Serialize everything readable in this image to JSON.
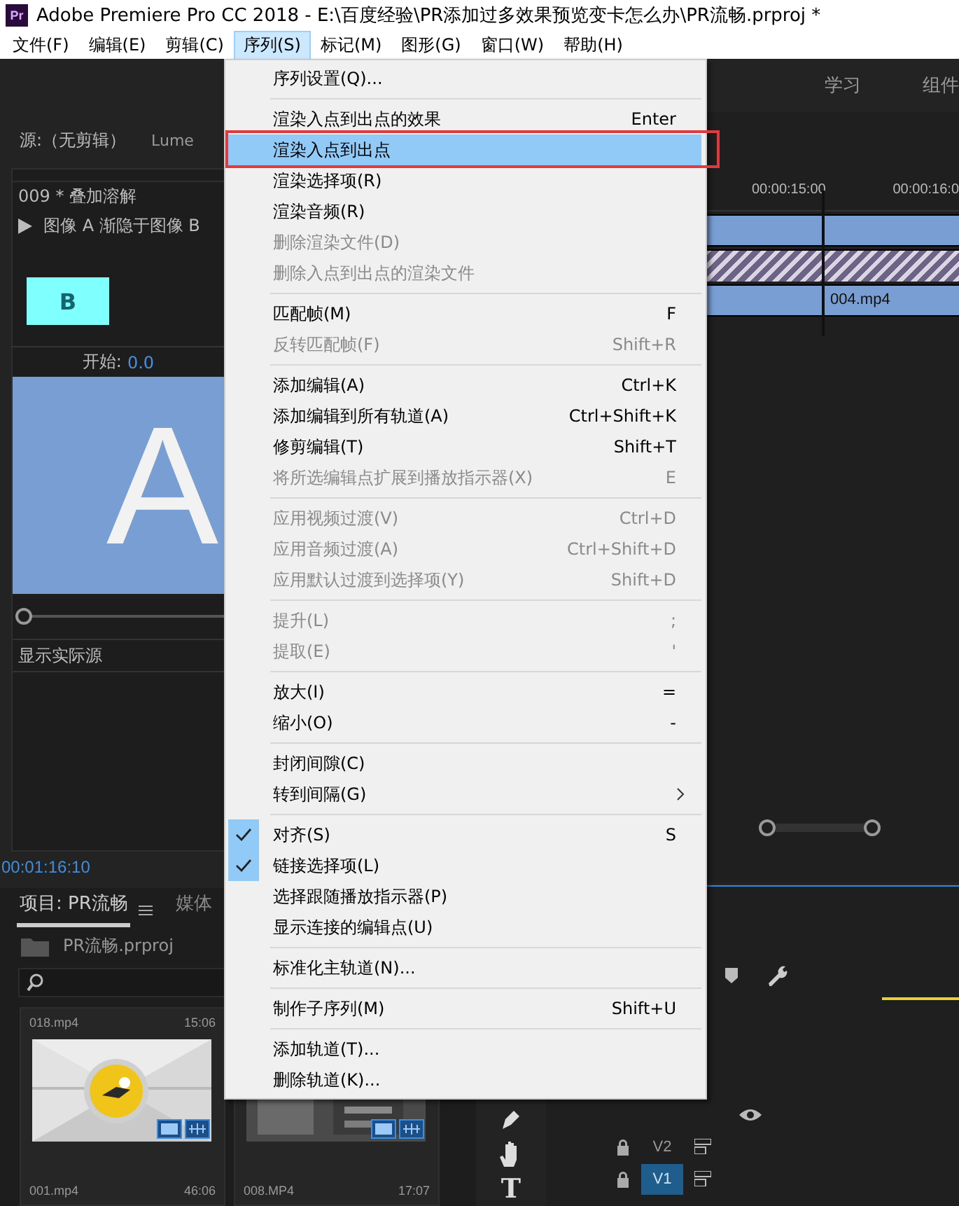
{
  "window": {
    "app_icon": "Pr",
    "title": "Adobe Premiere Pro CC 2018 - E:\\百度经验\\PR添加过多效果预览变卡怎么办\\PR流畅.prproj *"
  },
  "menu_bar": [
    {
      "label": "文件(F)",
      "selected": false
    },
    {
      "label": "编辑(E)",
      "selected": false
    },
    {
      "label": "剪辑(C)",
      "selected": false
    },
    {
      "label": "序列(S)",
      "selected": true
    },
    {
      "label": "标记(M)",
      "selected": false
    },
    {
      "label": "图形(G)",
      "selected": false
    },
    {
      "label": "窗口(W)",
      "selected": false
    },
    {
      "label": "帮助(H)",
      "selected": false
    }
  ],
  "workspaces": [
    "学习",
    "组件"
  ],
  "source_panel": {
    "tabs": [
      "源:（无剪辑）",
      "Lume"
    ]
  },
  "effect_controls": {
    "clip": "009 * 叠加溶解",
    "description": "图像 A 渐隐于图像 B",
    "thumb_b": "B",
    "start_label": "开始:",
    "start_value": "0.0",
    "preview_a": "A",
    "slider": {
      "level": 0
    },
    "show_source": "显示实际源",
    "timecode": "00:01:16:10"
  },
  "timeline": {
    "ruler": [
      "00:00:15:00",
      "00:00:16:0"
    ],
    "clips": [
      {
        "kind": "video"
      },
      {
        "kind": "transition"
      },
      {
        "kind": "video",
        "name": "004.mp4"
      }
    ],
    "track_labels": [
      {
        "label": "V2",
        "selected": false
      },
      {
        "label": "V1",
        "selected": true
      }
    ]
  },
  "tools": [
    {
      "kind": "pen"
    },
    {
      "kind": "hand"
    },
    {
      "kind": "type",
      "glyph": "T"
    }
  ],
  "project": {
    "tabs": [
      {
        "label": "项目: PR流畅",
        "selected": true
      },
      {
        "label": "媒体",
        "selected": false
      }
    ],
    "file": "PR流畅.prproj",
    "previous_row": [
      {
        "name": "018.mp4",
        "duration": "15:06"
      }
    ],
    "items": [
      {
        "name": "001.mp4",
        "duration": "46:06",
        "kind": "picture"
      },
      {
        "name": "008.MP4",
        "duration": "17:07",
        "kind": "picture"
      }
    ]
  },
  "menu": {
    "annotation_frame": true,
    "items": [
      {
        "kind": "item",
        "label": "序列设置(Q)...",
        "disabled": false,
        "checked": false,
        "selected": false
      },
      {
        "kind": "separator"
      },
      {
        "kind": "item",
        "label": "渲染入点到出点的效果",
        "shortcut": "Enter",
        "disabled": false,
        "checked": false,
        "selected": false
      },
      {
        "kind": "item",
        "label": "渲染入点到出点",
        "disabled": false,
        "checked": false,
        "selected": true
      },
      {
        "kind": "item",
        "label": "渲染选择项(R)",
        "disabled": false,
        "checked": false,
        "selected": false
      },
      {
        "kind": "item",
        "label": "渲染音频(R)",
        "disabled": false,
        "checked": false,
        "selected": false
      },
      {
        "kind": "item",
        "label": "删除渲染文件(D)",
        "disabled": true,
        "checked": false,
        "selected": false
      },
      {
        "kind": "item",
        "label": "删除入点到出点的渲染文件",
        "disabled": true,
        "checked": false,
        "selected": false
      },
      {
        "kind": "separator"
      },
      {
        "kind": "item",
        "label": "匹配帧(M)",
        "shortcut": "F",
        "disabled": false,
        "checked": false,
        "selected": false
      },
      {
        "kind": "item",
        "label": "反转匹配帧(F)",
        "shortcut": "Shift+R",
        "disabled": true,
        "checked": false,
        "selected": false
      },
      {
        "kind": "separator"
      },
      {
        "kind": "item",
        "label": "添加编辑(A)",
        "shortcut": "Ctrl+K",
        "disabled": false,
        "checked": false,
        "selected": false
      },
      {
        "kind": "item",
        "label": "添加编辑到所有轨道(A)",
        "shortcut": "Ctrl+Shift+K",
        "disabled": false,
        "checked": false,
        "selected": false
      },
      {
        "kind": "item",
        "label": "修剪编辑(T)",
        "shortcut": "Shift+T",
        "disabled": false,
        "checked": false,
        "selected": false
      },
      {
        "kind": "item",
        "label": "将所选编辑点扩展到播放指示器(X)",
        "shortcut": "E",
        "disabled": true,
        "checked": false,
        "selected": false
      },
      {
        "kind": "separator"
      },
      {
        "kind": "item",
        "label": "应用视频过渡(V)",
        "shortcut": "Ctrl+D",
        "disabled": true,
        "checked": false,
        "selected": false
      },
      {
        "kind": "item",
        "label": "应用音频过渡(A)",
        "shortcut": "Ctrl+Shift+D",
        "disabled": true,
        "checked": false,
        "selected": false
      },
      {
        "kind": "item",
        "label": "应用默认过渡到选择项(Y)",
        "shortcut": "Shift+D",
        "disabled": true,
        "checked": false,
        "selected": false
      },
      {
        "kind": "separator"
      },
      {
        "kind": "item",
        "label": "提升(L)",
        "shortcut": ";",
        "disabled": true,
        "checked": false,
        "selected": false
      },
      {
        "kind": "item",
        "label": "提取(E)",
        "shortcut": "'",
        "disabled": true,
        "checked": false,
        "selected": false
      },
      {
        "kind": "separator"
      },
      {
        "kind": "item",
        "label": "放大(I)",
        "shortcut": "=",
        "disabled": false,
        "checked": false,
        "selected": false
      },
      {
        "kind": "item",
        "label": "缩小(O)",
        "shortcut": "-",
        "disabled": false,
        "checked": false,
        "selected": false
      },
      {
        "kind": "separator"
      },
      {
        "kind": "item",
        "label": "封闭间隙(C)",
        "disabled": false,
        "checked": false,
        "selected": false
      },
      {
        "kind": "item",
        "label": "转到间隔(G)",
        "submenu": true,
        "disabled": false,
        "checked": false,
        "selected": false
      },
      {
        "kind": "separator"
      },
      {
        "kind": "item",
        "label": "对齐(S)",
        "shortcut": "S",
        "disabled": false,
        "checked": true,
        "selected": false
      },
      {
        "kind": "item",
        "label": "链接选择项(L)",
        "disabled": false,
        "checked": true,
        "selected": false
      },
      {
        "kind": "item",
        "label": "选择跟随播放指示器(P)",
        "disabled": false,
        "checked": false,
        "selected": false
      },
      {
        "kind": "item",
        "label": "显示连接的编辑点(U)",
        "disabled": false,
        "checked": false,
        "selected": false
      },
      {
        "kind": "separator"
      },
      {
        "kind": "item",
        "label": "标准化主轨道(N)...",
        "disabled": false,
        "checked": false,
        "selected": false
      },
      {
        "kind": "separator"
      },
      {
        "kind": "item",
        "label": "制作子序列(M)",
        "shortcut": "Shift+U",
        "disabled": false,
        "checked": false,
        "selected": false
      },
      {
        "kind": "separator"
      },
      {
        "kind": "item",
        "label": "添加轨道(T)...",
        "disabled": false,
        "checked": false,
        "selected": false
      },
      {
        "kind": "item",
        "label": "删除轨道(K)...",
        "disabled": false,
        "checked": false,
        "selected": false
      }
    ]
  }
}
